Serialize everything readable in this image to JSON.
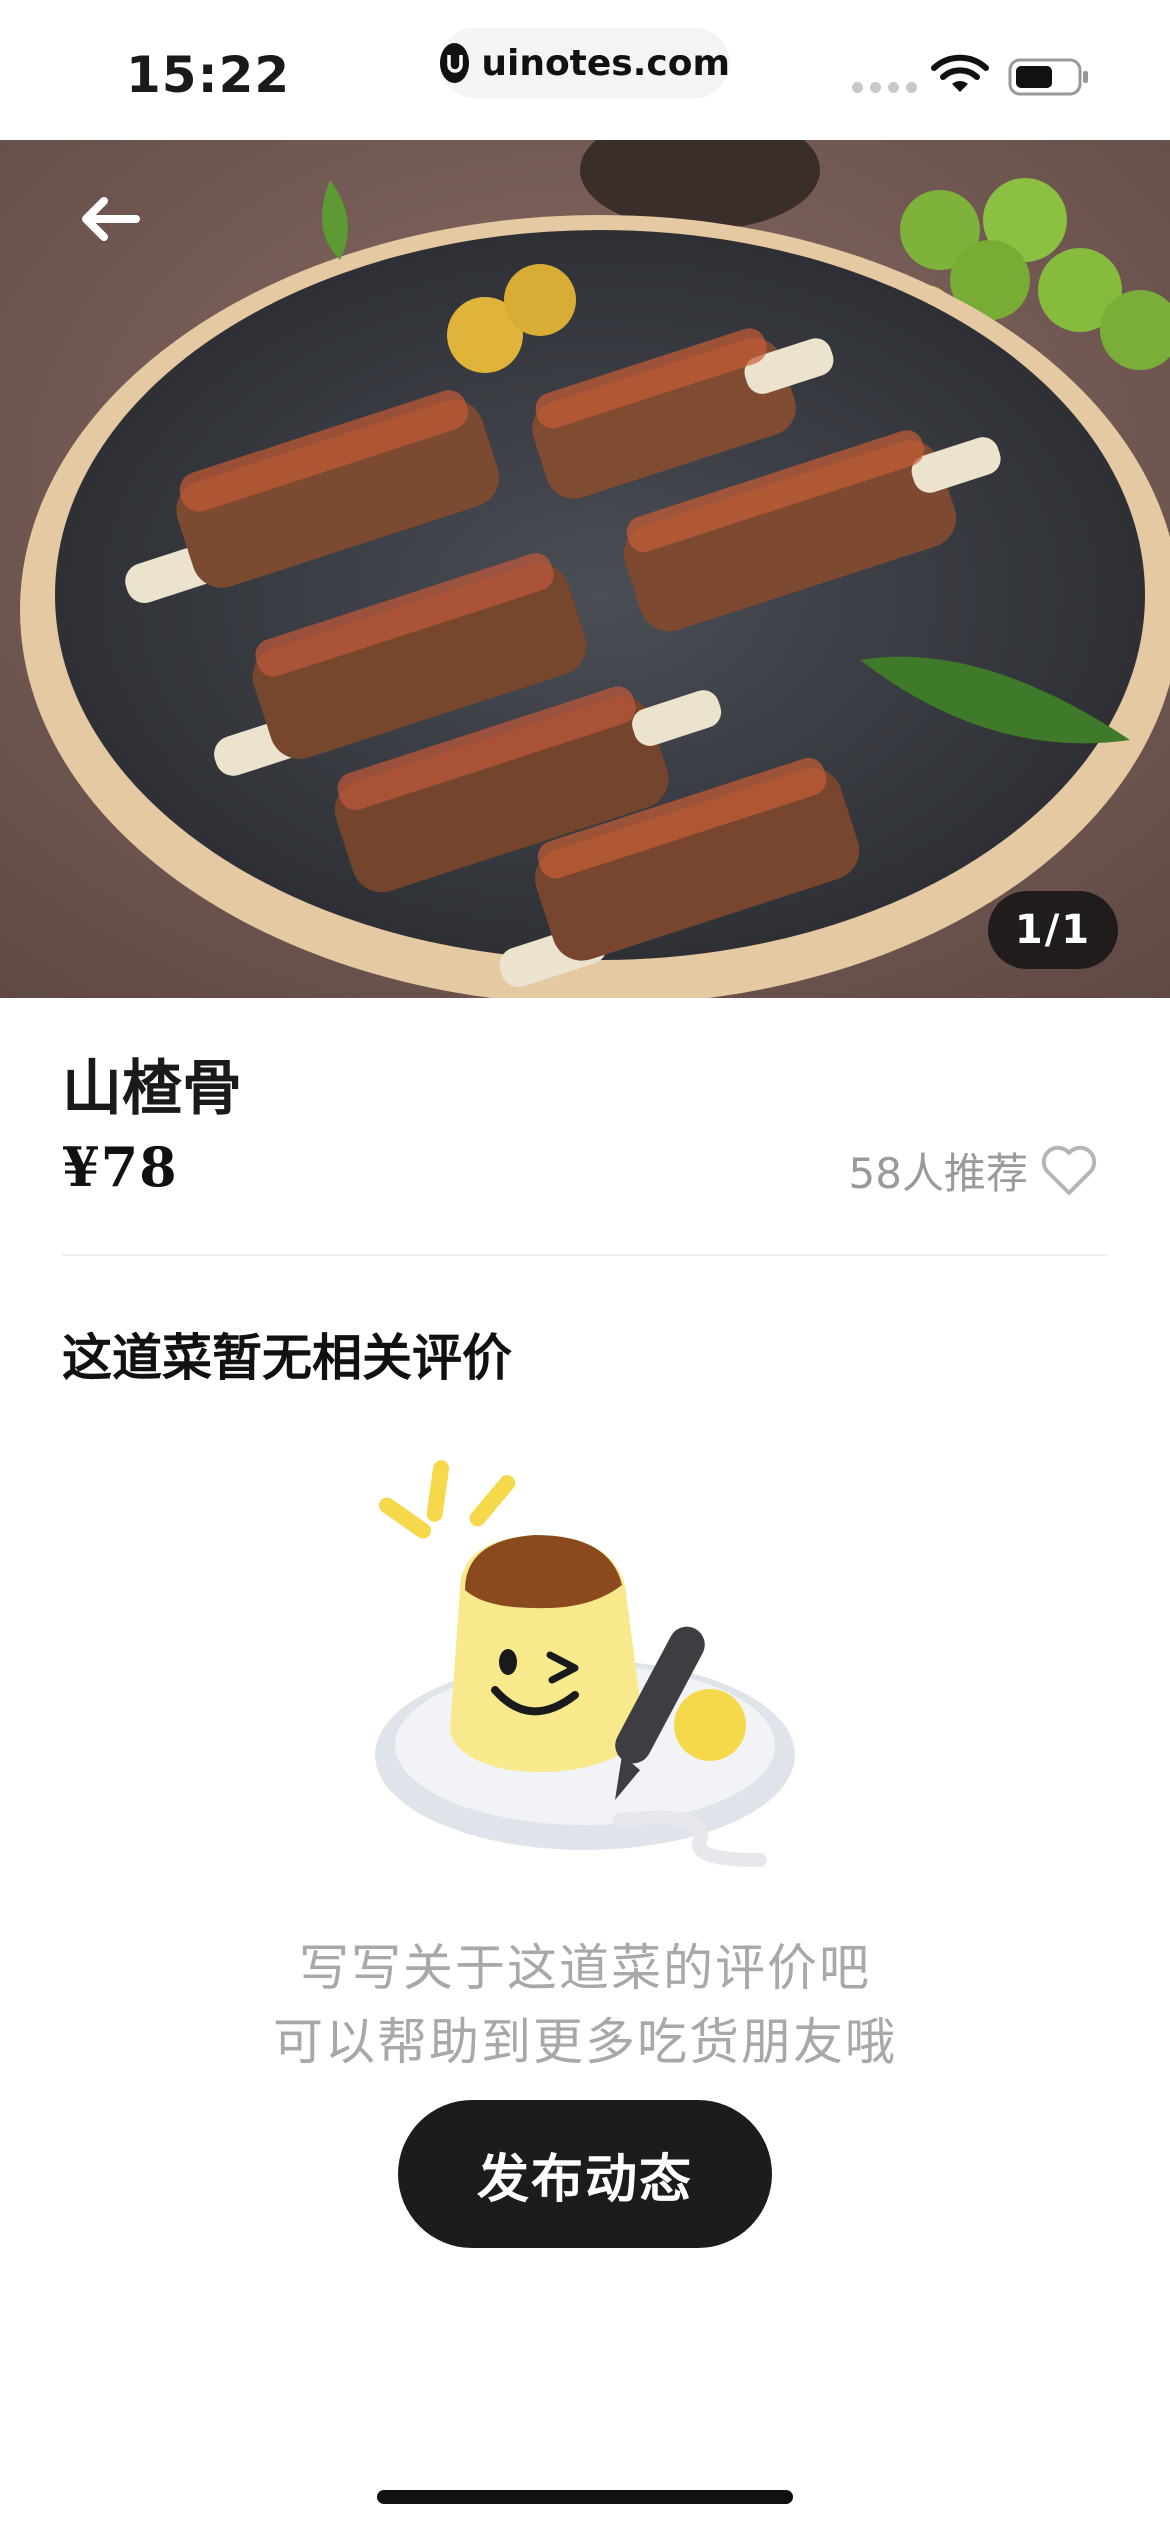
{
  "status_bar": {
    "time": "15:22",
    "url": "uinotes.com",
    "icons": [
      "signal-dots-icon",
      "wifi-icon",
      "battery-icon"
    ]
  },
  "hero": {
    "image_subject": "food-photo",
    "counter": "1/1",
    "back_icon": "arrow-left-icon"
  },
  "dish": {
    "name": "山楂骨",
    "price": "¥78",
    "recommend_text": "58人推荐",
    "recommend_icon": "heart-outline-icon"
  },
  "reviews": {
    "title": "这道菜暂无相关评价",
    "empty_line_1": "写写关于这道菜的评价吧",
    "empty_line_2": "可以帮助到更多吃货朋友哦",
    "post_button_label": "发布动态",
    "illustration_icon": "pudding-mascot-icon"
  },
  "colors": {
    "primary_button": "#1b1c1e",
    "muted_text": "#a8a8a8",
    "accent_yellow": "#f5d94a"
  }
}
